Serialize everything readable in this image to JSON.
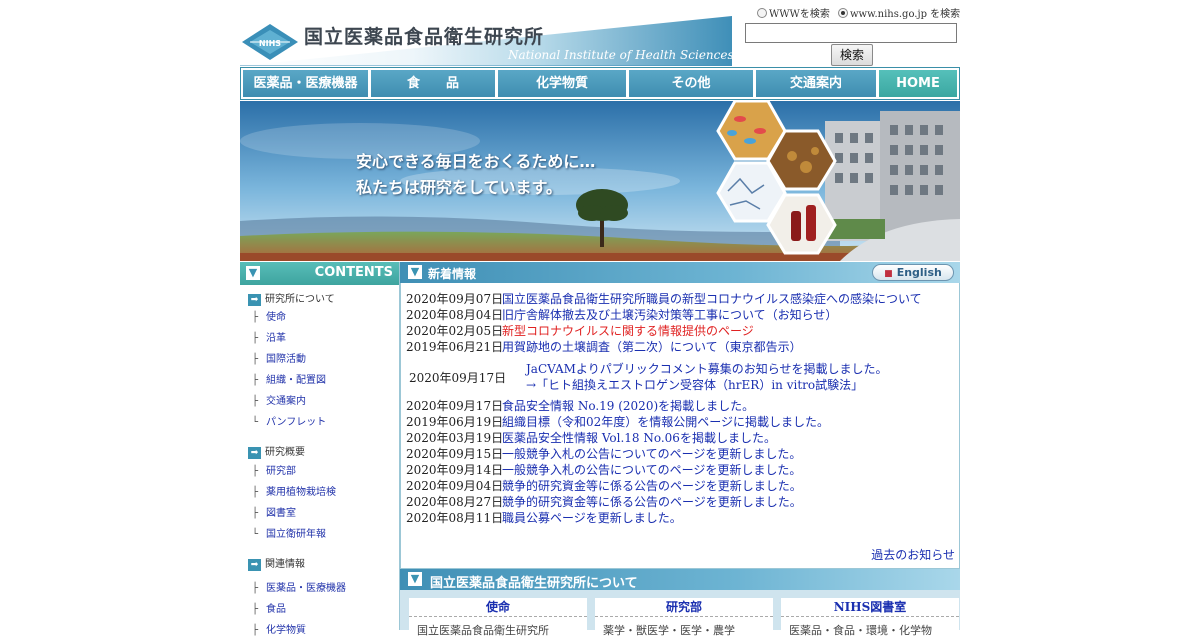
{
  "header": {
    "logo_jp": "国立医薬品食品衛生研究所",
    "logo_en": "National Institute of Health Sciences",
    "logo_mark_text": "NIHS"
  },
  "search": {
    "option_www": "WWWを検索",
    "option_site": "www.nihs.go.jp を検索",
    "selected": "www.nihs.go.jp を検索",
    "input_value": "",
    "button_label": "検索"
  },
  "nav": {
    "items": [
      {
        "label": "医薬品・医療機器"
      },
      {
        "label": "食　　品"
      },
      {
        "label": "化学物質"
      },
      {
        "label": "その他"
      },
      {
        "label": "交通案内"
      },
      {
        "label": "HOME"
      }
    ]
  },
  "banner": {
    "line1": "安心できる毎日をおくるために…",
    "line2": "私たちは研究をしています。"
  },
  "sidebar": {
    "title": "CONTENTS",
    "sections": [
      {
        "label": "研究所について",
        "items": [
          "使命",
          "沿革",
          "国際活動",
          "組織・配置図",
          "交通案内",
          "パンフレット"
        ]
      },
      {
        "label": "研究概要",
        "items": [
          "研究部",
          "薬用植物栽培検",
          "図書室",
          "国立衛研年報"
        ]
      },
      {
        "label": "関連情報",
        "items": [
          "医薬品・医療機器",
          "食品",
          "化学物質"
        ]
      }
    ]
  },
  "news": {
    "title": "新着情報",
    "english_label": "English",
    "items_top": [
      {
        "date": "2020年09月07日",
        "text": "国立医薬品食品衛生研究所職員の新型コロナウイルス感染症への感染について",
        "red": false
      },
      {
        "date": "2020年08月04日",
        "text": "旧庁舎解体撤去及び土壌汚染対策等工事について（お知らせ）",
        "red": false
      },
      {
        "date": "2020年02月05日",
        "text": "新型コロナウイルスに関する情報提供のページ",
        "red": true
      },
      {
        "date": "2019年06月21日",
        "text": "用賀跡地の土壌調査（第二次）について（東京都告示）",
        "red": false
      }
    ],
    "special": {
      "date": "2020年09月17日",
      "line1": "JaCVAMよりパブリックコメント募集のお知らせを掲載しました。",
      "line2": "→「ヒト組換えエストロゲン受容体（hrER）in vitro試験法」"
    },
    "items_bottom": [
      {
        "date": "2020年09月17日",
        "text": "食品安全情報 No.19 (2020)を掲載しました。"
      },
      {
        "date": "2019年06月19日",
        "text": "組織目標（令和02年度）を情報公開ページに掲載しました。"
      },
      {
        "date": "2020年03月19日",
        "text": "医薬品安全性情報 Vol.18 No.06を掲載しました。"
      },
      {
        "date": "2020年09月15日",
        "text": "一般競争入札の公告についてのページを更新しました。"
      },
      {
        "date": "2020年09月14日",
        "text": "一般競争入札の公告についてのページを更新しました。"
      },
      {
        "date": "2020年09月04日",
        "text": "競争的研究資金等に係る公告のページを更新しました。"
      },
      {
        "date": "2020年08月27日",
        "text": "競争的研究資金等に係る公告のページを更新しました。"
      },
      {
        "date": "2020年08月11日",
        "text": "職員公募ページを更新しました。"
      }
    ],
    "more_label": "過去のお知らせ"
  },
  "about": {
    "title": "国立医薬品食品衛生研究所について",
    "cards": [
      {
        "title": "使命",
        "text": "国立医薬品食品衛生研究所"
      },
      {
        "title": "研究部",
        "text": "薬学・獣医学・医学・農学"
      },
      {
        "title": "NIHS図書室",
        "text": "医薬品・食品・環境・化学物"
      }
    ]
  },
  "colors": {
    "nav_blue": "#4a9abd",
    "home_teal": "#3fb0aa",
    "link_blue": "#1a2fb0",
    "alert_red": "#e02222"
  }
}
